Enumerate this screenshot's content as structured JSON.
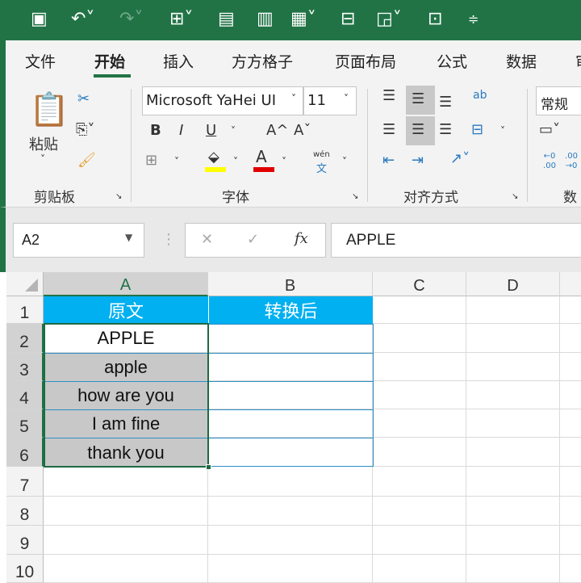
{
  "quick_access": {
    "icons": [
      "save-icon",
      "undo-icon",
      "redo-icon",
      "borders-icon",
      "form-icon",
      "chart-icon",
      "pivot-icon",
      "merge-icon",
      "shapes-icon",
      "textbox-icon",
      "customize-icon"
    ]
  },
  "tabs": [
    "文件",
    "开始",
    "插入",
    "方方格子",
    "页面布局",
    "公式",
    "数据",
    "审"
  ],
  "active_tab": "开始",
  "ribbon": {
    "clipboard": {
      "paste": "粘贴",
      "group": "剪贴板"
    },
    "font": {
      "name": "Microsoft YaHei UI",
      "size": "11",
      "bold": "B",
      "italic": "I",
      "underline": "U",
      "grow": "A^",
      "shrink": "Aˇ",
      "font_color": "A",
      "phonetic_top": "wén",
      "phonetic_bottom": "文",
      "group": "字体",
      "fill_color": "#ffff00",
      "text_color": "#e00000"
    },
    "alignment": {
      "group": "对齐方式",
      "wrap": "ab"
    },
    "number": {
      "format": "常规",
      "group": "数字",
      "dec_inc": "←0 .00",
      "dec_dec": ".00 →0"
    }
  },
  "formula_bar": {
    "name_box": "A2",
    "cancel": "✕",
    "enter": "✓",
    "fx": "fx",
    "value": "APPLE"
  },
  "columns": [
    "A",
    "B",
    "C",
    "D"
  ],
  "rows": [
    "1",
    "2",
    "3",
    "4",
    "5",
    "6",
    "7",
    "8",
    "9",
    "10"
  ],
  "cells": {
    "A1": "原文",
    "B1": "转换后",
    "A2": "APPLE",
    "A3": "apple",
    "A4": "how are you",
    "A5": "I am fine",
    "A6": "thank you"
  },
  "colors": {
    "header_fill": "#00b0f0",
    "selected_fill": "#c8c8c8",
    "accent": "#217346"
  }
}
